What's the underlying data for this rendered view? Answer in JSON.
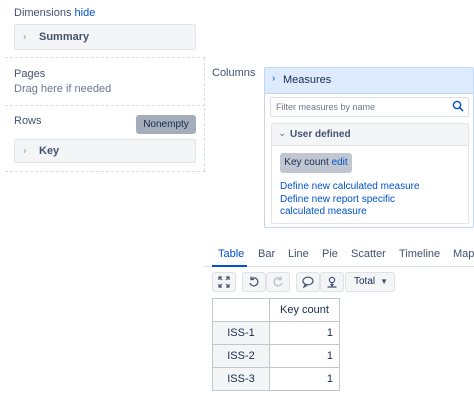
{
  "dimensions": {
    "title": "Dimensions",
    "hide_link": "hide",
    "summary_label": "Summary"
  },
  "pages": {
    "title": "Pages",
    "hint": "Drag here if needed"
  },
  "rows": {
    "title": "Rows",
    "nonempty_label": "Nonempty",
    "key_label": "Key"
  },
  "columns": {
    "title": "Columns"
  },
  "measures": {
    "title": "Measures",
    "filter_placeholder": "Filter measures by name",
    "user_defined_label": "User defined",
    "key_count_label": "Key count",
    "key_count_edit": "edit",
    "define_calculated": "Define new calculated measure",
    "define_report_line1": "Define new report specific",
    "define_report_line2": "calculated measure"
  },
  "tabs": [
    "Table",
    "Bar",
    "Line",
    "Pie",
    "Scatter",
    "Timeline",
    "Map"
  ],
  "active_tab": "Table",
  "toolbar": {
    "total_label": "Total"
  },
  "table": {
    "column_header": "Key count",
    "rows": [
      {
        "label": "ISS-1",
        "value": "1"
      },
      {
        "label": "ISS-2",
        "value": "1"
      },
      {
        "label": "ISS-3",
        "value": "1"
      }
    ]
  },
  "colors": {
    "accent": "#0052cc",
    "measures_header": "#deebff"
  }
}
